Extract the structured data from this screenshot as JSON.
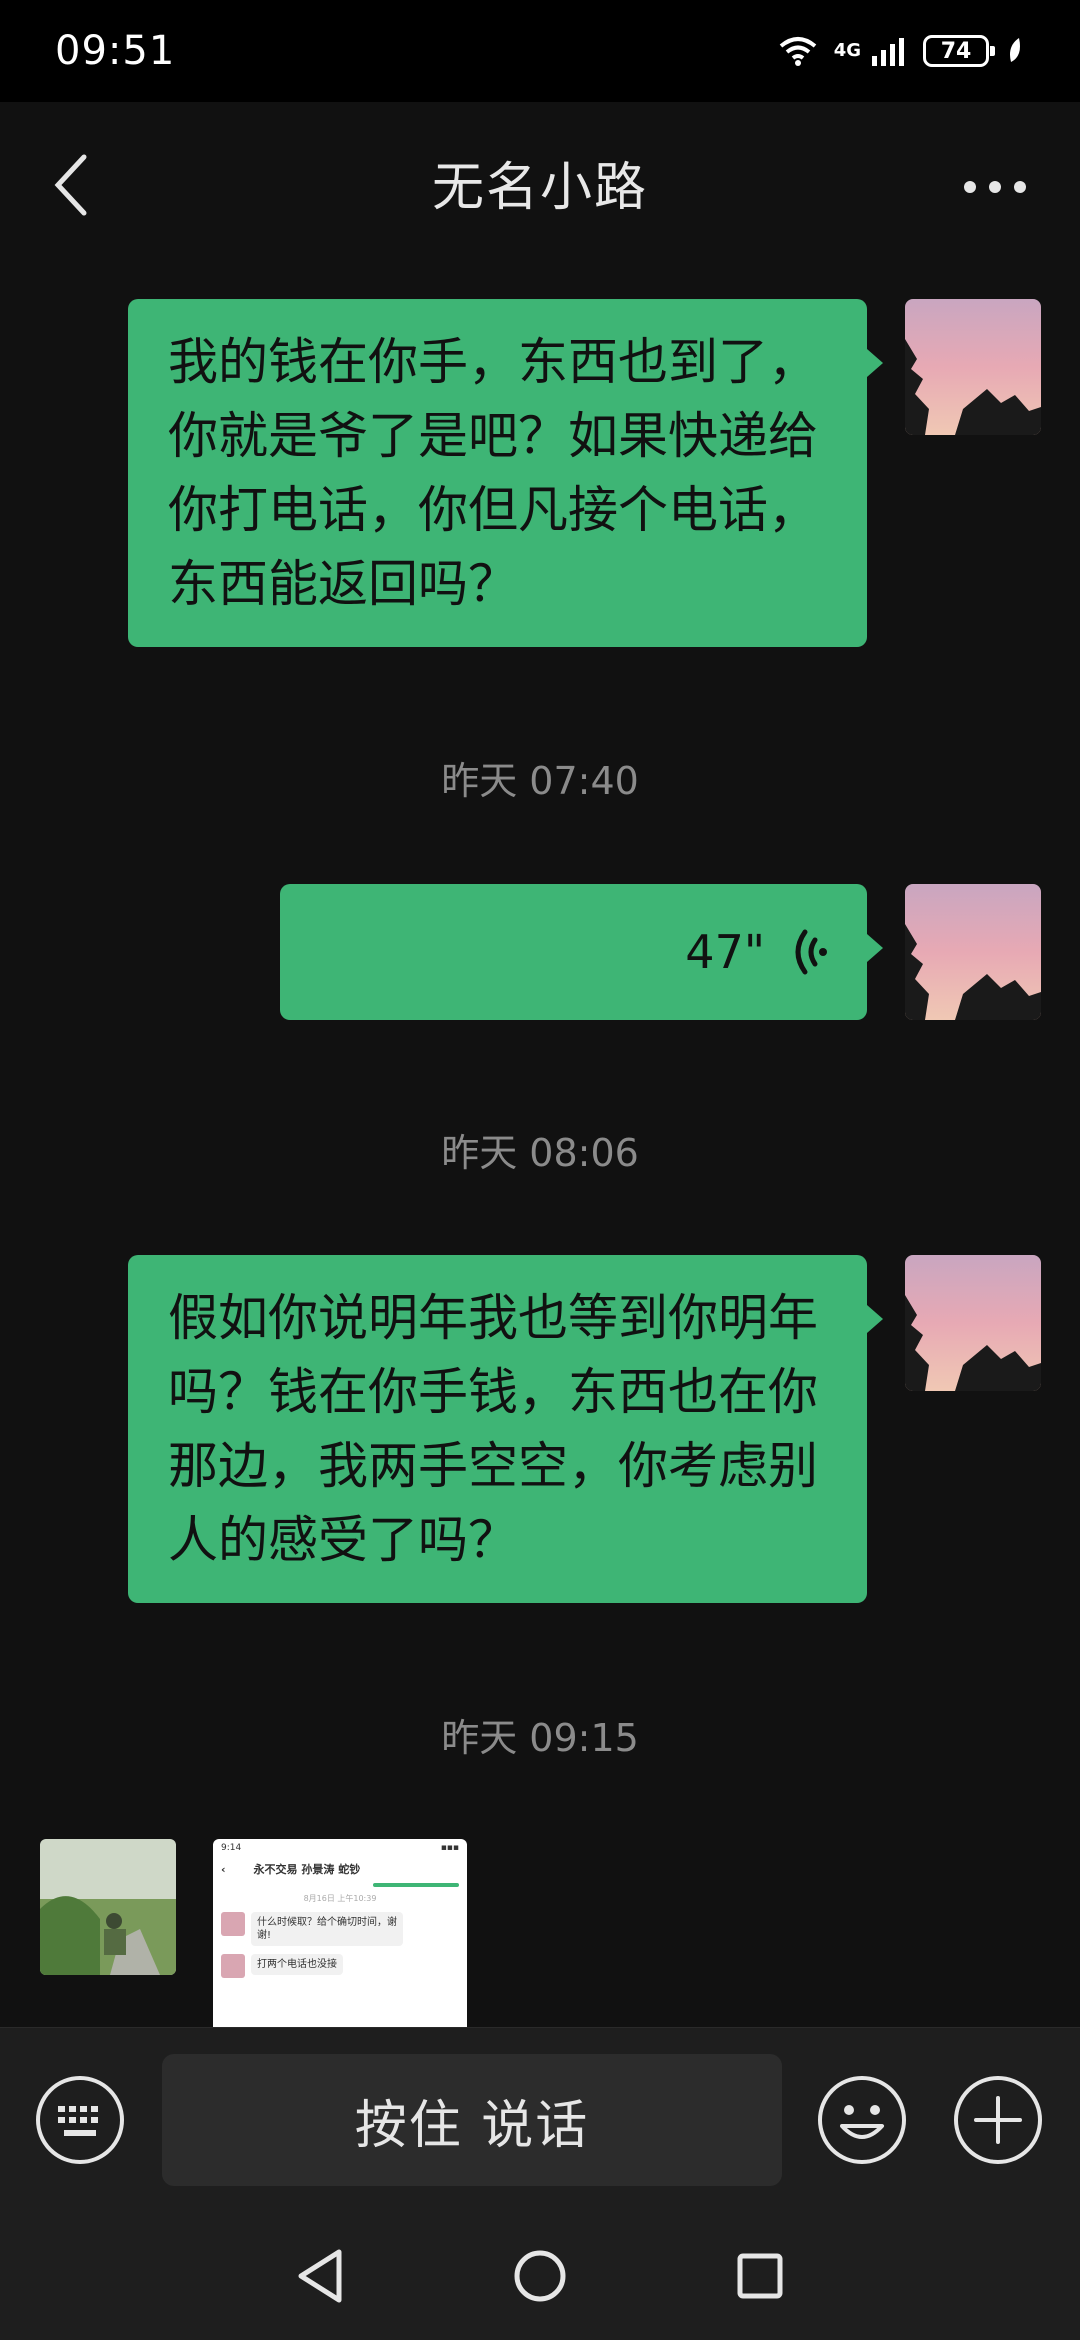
{
  "status_bar": {
    "time": "09:51",
    "network": "4G",
    "battery": "74"
  },
  "header": {
    "title": "无名小路"
  },
  "messages": [
    {
      "type": "text",
      "text": "我的钱在你手，东西也到了，你就是爷了是吧？如果快递给你打电话，你但凡接个电话，东西能返回吗？"
    },
    {
      "type": "timestamp",
      "text": "昨天 07:40"
    },
    {
      "type": "voice",
      "duration": "47\""
    },
    {
      "type": "timestamp",
      "text": "昨天 08:06"
    },
    {
      "type": "text",
      "text": "假如你说明年我也等到你明年吗？钱在你手钱，东西也在你那边，我两手空空，你考虑别人的感受了吗？"
    },
    {
      "type": "timestamp",
      "text": "昨天 09:15"
    }
  ],
  "screenshot_preview": {
    "time": "9:14",
    "title": "永不交易  孙景涛 蛇钞",
    "date": "8月16日 上午10:39",
    "msg1": "什么时候取？给个确切时间，谢谢!",
    "msg2": "打两个电话也没接"
  },
  "input_bar": {
    "talk_label": "按住 说话"
  },
  "icons": {
    "back": "chevron-left-icon",
    "more": "more-dots-icon",
    "voice": "voice-wave-icon",
    "keyboard": "keyboard-icon",
    "emoji": "emoji-icon",
    "plus": "plus-icon",
    "sys_back": "triangle-back-icon",
    "sys_home": "circle-home-icon",
    "sys_recent": "square-recent-icon"
  },
  "colors": {
    "bubble_green": "#3eb575",
    "background": "#111111",
    "input_bg": "#1e1e1e"
  }
}
